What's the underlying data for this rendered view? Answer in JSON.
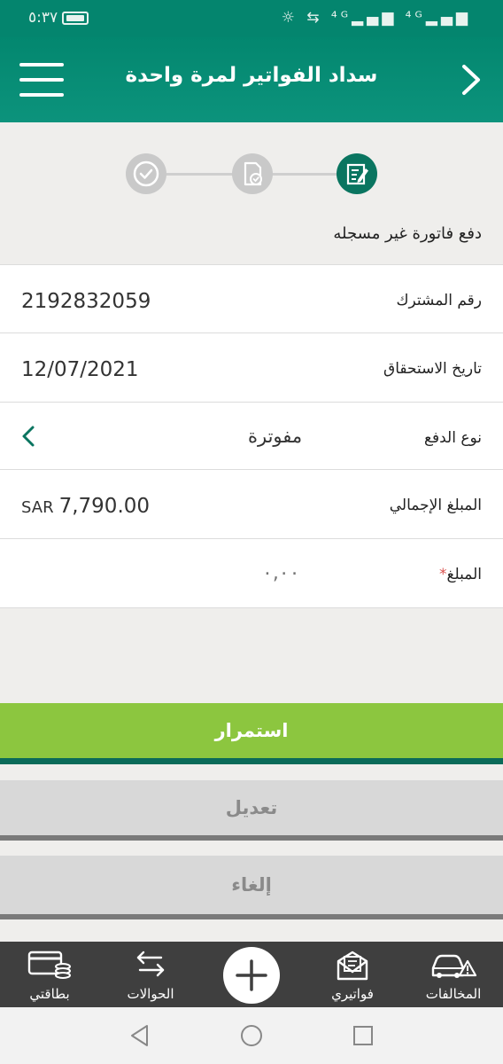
{
  "status_bar": {
    "time": "٥:٣٧",
    "icons_text": "☼ ⇆ ⁴ᴳ▂▄▆ ⁴ᴳ▂▄▆"
  },
  "app_bar": {
    "title": "سداد الفواتير لمرة واحدة"
  },
  "stepper": {
    "caption": "دفع فاتورة غير مسجله",
    "active_step": 1
  },
  "form": {
    "subscriber": {
      "label": "رقم المشترك",
      "value": "2192832059"
    },
    "due_date": {
      "label": "تاريخ الاستحقاق",
      "value": "12/07/2021"
    },
    "payment_type": {
      "label": "نوع الدفع",
      "value": "مفوترة"
    },
    "total": {
      "label": "المبلغ الإجمالي",
      "amount": "7,790.00",
      "currency": "SAR"
    },
    "amount": {
      "label": "المبلغ",
      "required_mark": "*",
      "placeholder": "٠,٠٠"
    }
  },
  "buttons": {
    "continue": "استمرار",
    "edit": "تعديل",
    "cancel": "إلغاء"
  },
  "bottom_nav": {
    "violations": "المخالفات",
    "my_bills": "فواتيري",
    "transfers": "الحوالات",
    "my_cards": "بطاقتي"
  },
  "colors": {
    "brand_green": "#04856e",
    "accent_lime": "#8cc63f",
    "nav_dark": "#3f3f3f"
  },
  "icons": [
    "menu-icon",
    "back-chevron-icon",
    "edit-doc-icon",
    "doc-check-icon",
    "check-circle-icon",
    "chevron-left-icon",
    "car-warning-icon",
    "bill-envelope-icon",
    "plus-icon",
    "transfer-arrows-icon",
    "cards-coins-icon"
  ]
}
